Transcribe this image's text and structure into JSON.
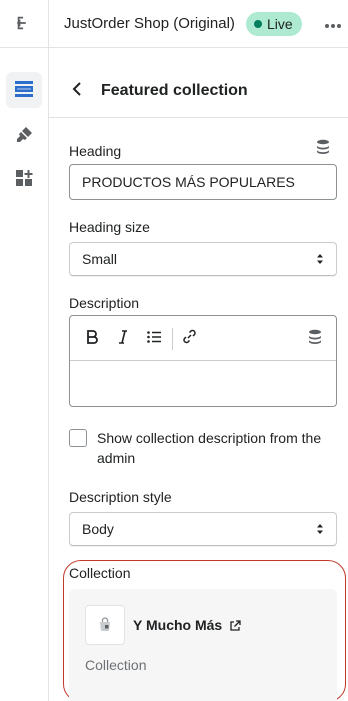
{
  "topbar": {
    "exit_icon": "exit-icon",
    "shop_name": "JustOrder Shop (Original)",
    "status_badge": "Live",
    "status_color": "#aee9d1",
    "more_icon": "more-horizontal-icon"
  },
  "rail": {
    "items": [
      {
        "icon": "sections-icon",
        "active": true
      },
      {
        "icon": "theme-settings-icon",
        "active": false
      },
      {
        "icon": "apps-icon",
        "active": false
      }
    ]
  },
  "panel": {
    "title": "Featured collection",
    "heading": {
      "label": "Heading",
      "value": "PRODUCTOS MÁS POPULARES"
    },
    "heading_size": {
      "label": "Heading size",
      "selected": "Small"
    },
    "description": {
      "label": "Description",
      "toolbar": [
        "bold-icon",
        "italic-icon",
        "bulleted-list-icon",
        "link-icon",
        "dynamic-source-icon"
      ],
      "value": ""
    },
    "show_description": {
      "label": "Show collection description from the admin",
      "checked": false
    },
    "description_style": {
      "label": "Description style",
      "selected": "Body"
    },
    "collection": {
      "label": "Collection",
      "name": "Y Mucho Más",
      "type": "Collection"
    }
  },
  "colors": {
    "accent": "#2c6ecb",
    "highlight_outline": "#c0392b"
  }
}
